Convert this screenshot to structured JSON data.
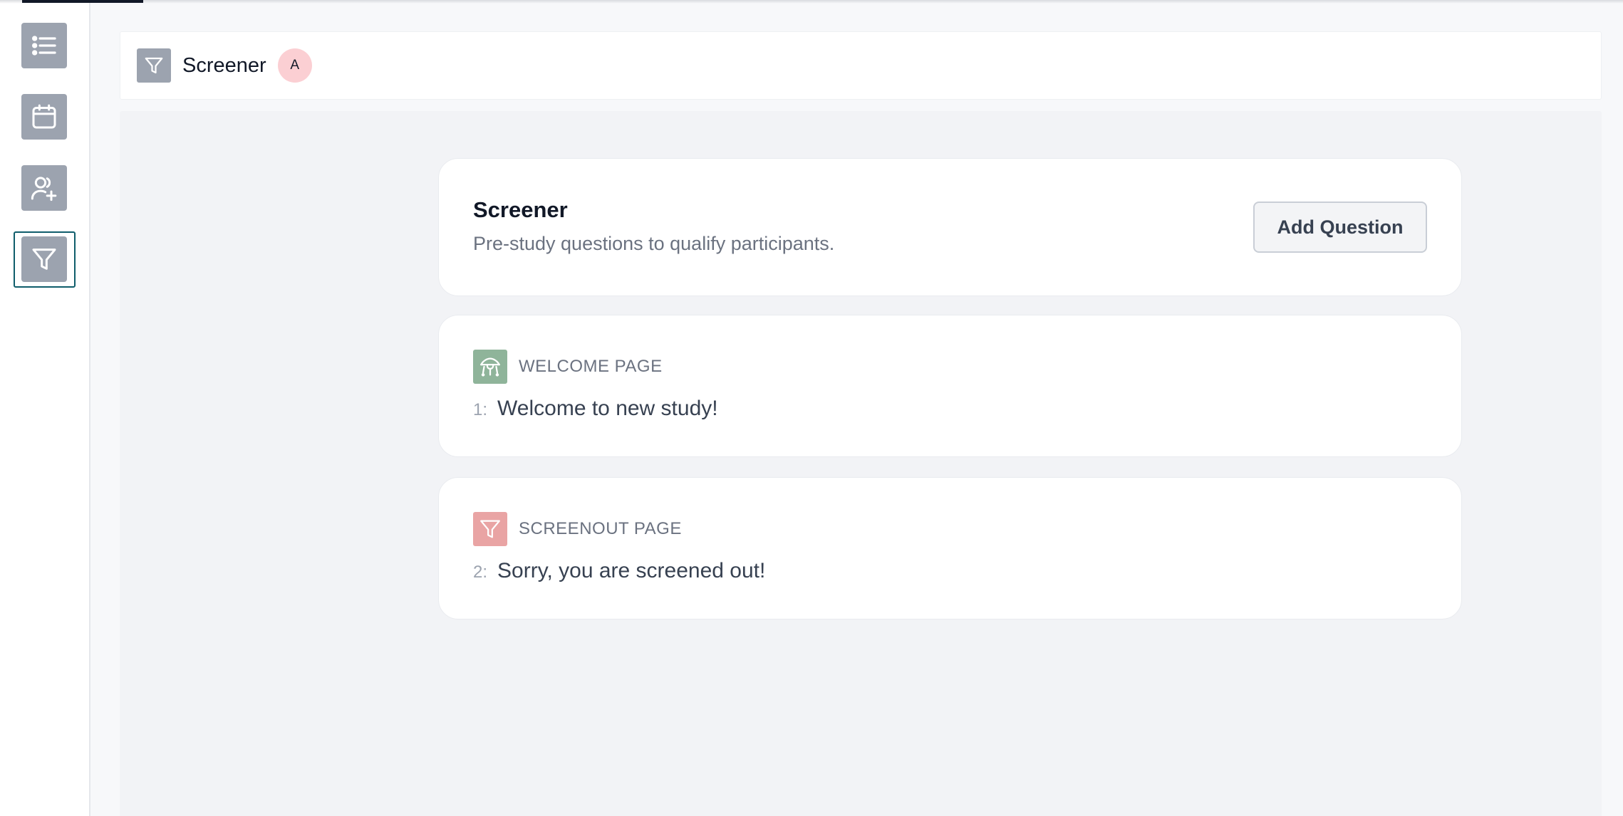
{
  "sidebar": {
    "items": [
      {
        "name": "list",
        "icon": "list-icon"
      },
      {
        "name": "calendar",
        "icon": "calendar-icon"
      },
      {
        "name": "add-participant",
        "icon": "user-plus-icon"
      },
      {
        "name": "screener",
        "icon": "filter-icon",
        "active": true
      }
    ]
  },
  "header": {
    "title": "Screener",
    "avatar_initial": "A"
  },
  "intro": {
    "title": "Screener",
    "subtitle": "Pre-study questions to qualify participants.",
    "add_button": "Add Question"
  },
  "pages": [
    {
      "label": "WELCOME PAGE",
      "number": "1:",
      "text": "Welcome to new study!",
      "icon": "welcome-icon",
      "color": "#8fb49a"
    },
    {
      "label": "SCREENOUT PAGE",
      "number": "2:",
      "text": "Sorry, you are screened out!",
      "icon": "filter-icon",
      "color": "#e9a4a4"
    }
  ]
}
